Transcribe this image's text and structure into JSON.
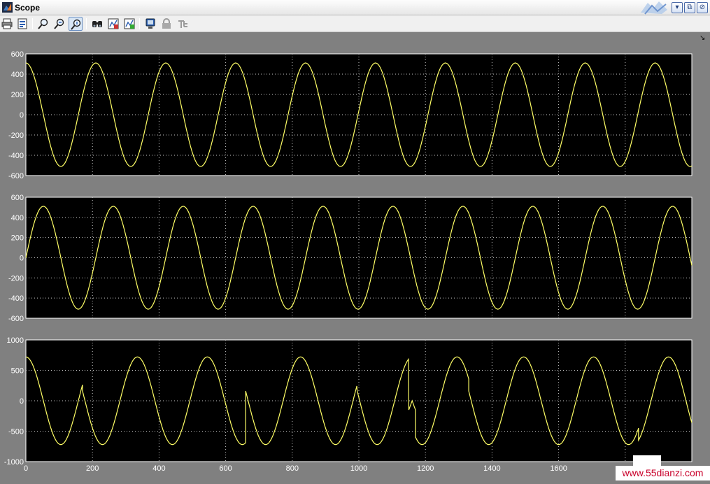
{
  "window": {
    "title": "Scope",
    "buttons": {
      "minimize": "▾",
      "restore": "⧉",
      "close": "⊘"
    }
  },
  "toolbar": {
    "items": [
      "print-icon",
      "parameters-icon",
      "zoom-icon",
      "zoom-x-icon",
      "zoom-y-icon",
      "autoscale-icon",
      "save-axes-icon",
      "restore-axes-icon",
      "floating-scope-icon",
      "lock-icon",
      "signal-selection-icon"
    ],
    "dock_arrow": "↘"
  },
  "watermark": {
    "text": "www.55dianzi.com"
  },
  "colors": {
    "plot_bg": "#000000",
    "trace": "#ffff66",
    "figure_bg": "#808080",
    "grid": "#c8c8c8"
  },
  "chart_data": [
    {
      "type": "line",
      "xlim": [
        0,
        2000
      ],
      "ylim": [
        -600,
        600
      ],
      "yticks": [
        600,
        400,
        200,
        0,
        -200,
        -400,
        -600
      ],
      "xticks": [],
      "grid": true,
      "series": [
        {
          "waveform": "cosine",
          "amplitude": 510,
          "period": 210,
          "phase_deg": 0,
          "x_range": [
            0,
            2000
          ]
        }
      ]
    },
    {
      "type": "line",
      "xlim": [
        0,
        2000
      ],
      "ylim": [
        -600,
        600
      ],
      "yticks": [
        600,
        400,
        200,
        0,
        -200,
        -400,
        -600
      ],
      "xticks": [],
      "grid": true,
      "series": [
        {
          "waveform": "sine",
          "amplitude": 510,
          "period": 210,
          "phase_deg": 0,
          "x_range": [
            0,
            2000
          ]
        }
      ]
    },
    {
      "type": "line",
      "xlim": [
        0,
        2000
      ],
      "ylim": [
        -1000,
        1000
      ],
      "yticks": [
        1000,
        500,
        0,
        -500,
        -1000
      ],
      "xticks": [
        0,
        200,
        400,
        600,
        800,
        1000,
        1200,
        1400,
        1600
      ],
      "grid": true,
      "series": [
        {
          "waveform": "cosine-with-jumps",
          "amplitude": 720,
          "period": 210,
          "points": [
            [
              0,
              720
            ],
            [
              170,
              -490
            ],
            [
              170,
              470
            ],
            [
              660,
              -660
            ],
            [
              660,
              720
            ],
            [
              995,
              -700
            ],
            [
              995,
              720
            ],
            [
              1150,
              -150
            ],
            [
              1160,
              0
            ],
            [
              1170,
              -150
            ],
            [
              1330,
              -720
            ],
            [
              1330,
              720
            ],
            [
              1840,
              280
            ],
            [
              1840,
              -300
            ]
          ]
        }
      ]
    }
  ]
}
